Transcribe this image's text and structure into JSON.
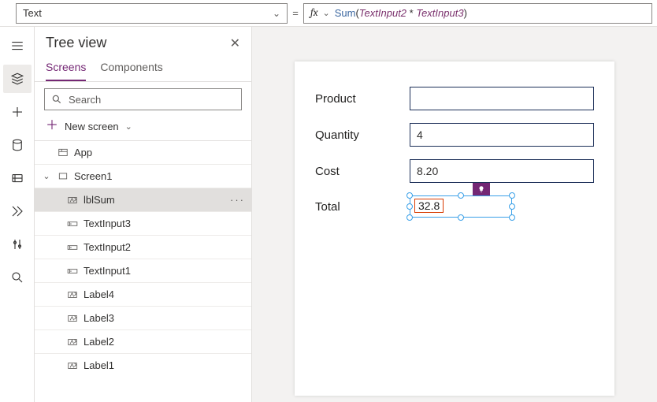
{
  "topbar": {
    "property": "Text",
    "formula_fn": "Sum",
    "formula_id1": "TextInput2",
    "formula_id2": "TextInput3"
  },
  "tree": {
    "title": "Tree view",
    "tabs": {
      "screens": "Screens",
      "components": "Components"
    },
    "search_placeholder": "Search",
    "new_screen": "New screen",
    "app": "App",
    "screen": "Screen1",
    "items": [
      "lblSum",
      "TextInput3",
      "TextInput2",
      "TextInput1",
      "Label4",
      "Label3",
      "Label2",
      "Label1"
    ]
  },
  "form": {
    "product_label": "Product",
    "product_value": "",
    "quantity_label": "Quantity",
    "quantity_value": "4",
    "cost_label": "Cost",
    "cost_value": "8.20",
    "total_label": "Total",
    "total_value": "32.8"
  }
}
